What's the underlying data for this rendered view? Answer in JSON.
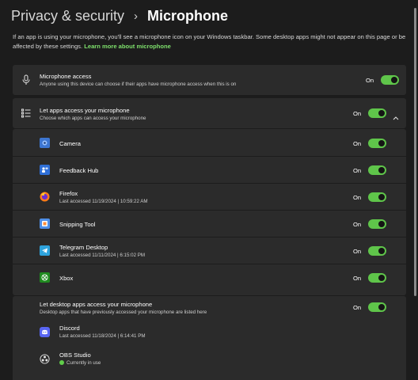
{
  "breadcrumb": {
    "parent": "Privacy & security",
    "separator": "›",
    "current": "Microphone"
  },
  "description": {
    "text": "If an app is using your microphone, you'll see a microphone icon on your Windows taskbar. Some desktop apps might not appear on this page or be affected by these settings. ",
    "link": "Learn more about microphone"
  },
  "microphone_access": {
    "title": "Microphone access",
    "subtitle": "Anyone using this device can choose if their apps have microphone access when this is on",
    "state": "On"
  },
  "let_apps": {
    "title": "Let apps access your microphone",
    "subtitle": "Choose which apps can access your microphone",
    "state": "On"
  },
  "apps": [
    {
      "name": "Camera",
      "last": "",
      "state": "On"
    },
    {
      "name": "Feedback Hub",
      "last": "",
      "state": "On"
    },
    {
      "name": "Firefox",
      "last": "Last accessed 11/19/2024  |  10:59:22 AM",
      "state": "On"
    },
    {
      "name": "Snipping Tool",
      "last": "",
      "state": "On"
    },
    {
      "name": "Telegram Desktop",
      "last": "Last accessed 11/11/2024  |  6:15:02 PM",
      "state": "On"
    },
    {
      "name": "Xbox",
      "last": "",
      "state": "On"
    }
  ],
  "desktop_apps": {
    "title": "Let desktop apps access your microphone",
    "subtitle": "Desktop apps that have previously accessed your microphone are listed here",
    "state": "On",
    "items": [
      {
        "name": "Discord",
        "last": "Last accessed 11/18/2024  |  6:14:41 PM"
      },
      {
        "name": "OBS Studio",
        "status": "Currently in use"
      }
    ]
  },
  "colors": {
    "accent": "#5fc54a",
    "link": "#7ee06c",
    "card": "#2b2b2b",
    "background": "#1c1c1c"
  }
}
